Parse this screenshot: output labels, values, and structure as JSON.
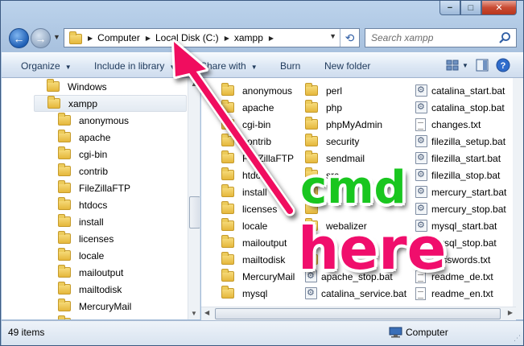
{
  "window": {
    "caption_buttons": {
      "minimize": "−",
      "maximize": "□",
      "close": "✕"
    }
  },
  "address": {
    "crumbs": [
      "Computer",
      "Local Disk (C:)",
      "xampp"
    ],
    "search_placeholder": "Search xampp"
  },
  "toolbar": {
    "organize": "Organize",
    "include_in_library": "Include in library",
    "share_with": "Share with",
    "burn": "Burn",
    "new_folder": "New folder"
  },
  "nav_tree": {
    "items": [
      {
        "label": "Windows",
        "level": 0
      },
      {
        "label": "xampp",
        "level": 0,
        "selected": true
      },
      {
        "label": "anonymous",
        "level": 1
      },
      {
        "label": "apache",
        "level": 1
      },
      {
        "label": "cgi-bin",
        "level": 1
      },
      {
        "label": "contrib",
        "level": 1
      },
      {
        "label": "FileZillaFTP",
        "level": 1
      },
      {
        "label": "htdocs",
        "level": 1
      },
      {
        "label": "install",
        "level": 1
      },
      {
        "label": "licenses",
        "level": 1
      },
      {
        "label": "locale",
        "level": 1
      },
      {
        "label": "mailoutput",
        "level": 1
      },
      {
        "label": "mailtodisk",
        "level": 1
      },
      {
        "label": "MercuryMail",
        "level": 1
      },
      {
        "label": "mysql",
        "level": 1
      }
    ]
  },
  "files": {
    "columns": [
      [
        {
          "name": "anonymous",
          "type": "folder"
        },
        {
          "name": "apache",
          "type": "folder"
        },
        {
          "name": "cgi-bin",
          "type": "folder"
        },
        {
          "name": "contrib",
          "type": "folder"
        },
        {
          "name": "FileZillaFTP",
          "type": "folder"
        },
        {
          "name": "htdocs",
          "type": "folder"
        },
        {
          "name": "install",
          "type": "folder"
        },
        {
          "name": "licenses",
          "type": "folder"
        },
        {
          "name": "locale",
          "type": "folder"
        },
        {
          "name": "mailoutput",
          "type": "folder"
        },
        {
          "name": "mailtodisk",
          "type": "folder"
        },
        {
          "name": "MercuryMail",
          "type": "folder"
        },
        {
          "name": "mysql",
          "type": "folder"
        }
      ],
      [
        {
          "name": "perl",
          "type": "folder"
        },
        {
          "name": "php",
          "type": "folder"
        },
        {
          "name": "phpMyAdmin",
          "type": "folder"
        },
        {
          "name": "security",
          "type": "folder"
        },
        {
          "name": "sendmail",
          "type": "folder"
        },
        {
          "name": "src",
          "type": "folder"
        },
        {
          "name": "",
          "type": "folder"
        },
        {
          "name": "",
          "type": "folder"
        },
        {
          "name": "webalizer",
          "type": "folder"
        },
        {
          "name": "",
          "type": "folder"
        },
        {
          "name": "",
          "type": "folder"
        },
        {
          "name": "apache_stop.bat",
          "type": "bat"
        },
        {
          "name": "catalina_service.bat",
          "type": "bat"
        }
      ],
      [
        {
          "name": "catalina_start.bat",
          "type": "bat"
        },
        {
          "name": "catalina_stop.bat",
          "type": "bat"
        },
        {
          "name": "changes.txt",
          "type": "txt"
        },
        {
          "name": "filezilla_setup.bat",
          "type": "bat"
        },
        {
          "name": "filezilla_start.bat",
          "type": "bat"
        },
        {
          "name": "filezilla_stop.bat",
          "type": "bat"
        },
        {
          "name": "mercury_start.bat",
          "type": "bat"
        },
        {
          "name": "mercury_stop.bat",
          "type": "bat"
        },
        {
          "name": "mysql_start.bat",
          "type": "bat"
        },
        {
          "name": "mysql_stop.bat",
          "type": "bat"
        },
        {
          "name": "passwords.txt",
          "type": "txt"
        },
        {
          "name": "readme_de.txt",
          "type": "txt"
        },
        {
          "name": "readme_en.txt",
          "type": "txt"
        }
      ]
    ]
  },
  "status": {
    "item_count": "49 items",
    "location": "Computer"
  },
  "annotation": {
    "line1": "cmd",
    "line2": "here",
    "line1_color": "#19c61f",
    "line2_color": "#f00e6c",
    "arrow_color": "#f0115f"
  },
  "colors": {
    "accent": "#2f5ea5",
    "folder": "#e5b73c"
  }
}
